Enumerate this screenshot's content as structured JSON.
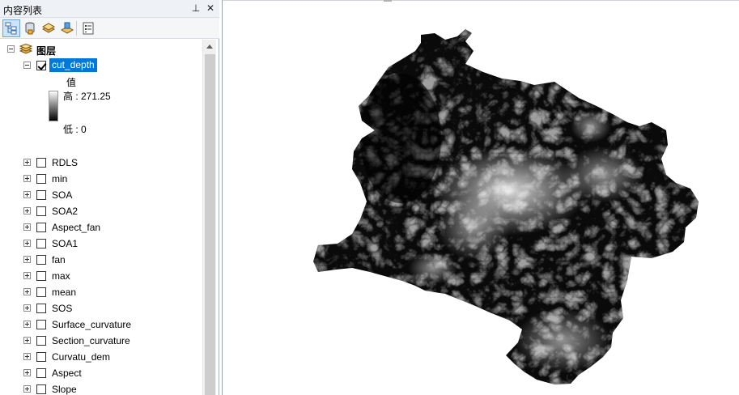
{
  "toc": {
    "title": "内容列表",
    "pin_glyph": "⊥",
    "close_glyph": "✕",
    "toolbar": [
      {
        "name": "list-by-drawing-order",
        "icon": "drawing-order-icon"
      },
      {
        "name": "list-by-source",
        "icon": "source-icon"
      },
      {
        "name": "list-by-visibility",
        "icon": "visibility-icon"
      },
      {
        "name": "list-by-selection",
        "icon": "selection-icon"
      },
      {
        "name": "options",
        "icon": "options-icon"
      }
    ],
    "root_label": "图层",
    "selected_layer": {
      "label": "cut_depth",
      "checked": true,
      "legend_title": "值",
      "high_label": "高 : 271.25",
      "low_label": "低 : 0"
    },
    "layers": [
      {
        "label": "RDLS",
        "checked": false
      },
      {
        "label": "min",
        "checked": false
      },
      {
        "label": "SOA",
        "checked": false
      },
      {
        "label": "SOA2",
        "checked": false
      },
      {
        "label": "Aspect_fan",
        "checked": false
      },
      {
        "label": "SOA1",
        "checked": false
      },
      {
        "label": "fan",
        "checked": false
      },
      {
        "label": "max",
        "checked": false
      },
      {
        "label": "mean",
        "checked": false
      },
      {
        "label": "SOS",
        "checked": false
      },
      {
        "label": "Surface_curvature",
        "checked": false
      },
      {
        "label": "Section_curvature",
        "checked": false
      },
      {
        "label": "Curvatu_dem",
        "checked": false
      },
      {
        "label": "Aspect",
        "checked": false
      },
      {
        "label": "Slope",
        "checked": false
      }
    ]
  },
  "colors": {
    "selection": "#0078d7",
    "raster_low": "#000000",
    "raster_high": "#ffffff"
  }
}
